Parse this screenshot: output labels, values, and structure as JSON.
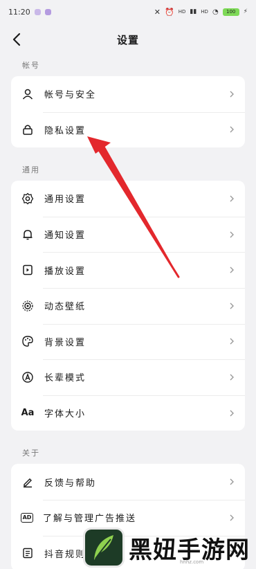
{
  "status_bar": {
    "time": "11:20",
    "signal_label": "HD",
    "battery": "100"
  },
  "header": {
    "title": "设置"
  },
  "sections": [
    {
      "label": "帐号",
      "items": [
        {
          "label": "帐号与安全",
          "icon": "user-icon"
        },
        {
          "label": "隐私设置",
          "icon": "lock-icon"
        }
      ]
    },
    {
      "label": "通用",
      "items": [
        {
          "label": "通用设置",
          "icon": "gear-icon"
        },
        {
          "label": "通知设置",
          "icon": "bell-icon"
        },
        {
          "label": "播放设置",
          "icon": "play-settings-icon"
        },
        {
          "label": "动态壁纸",
          "icon": "live-wallpaper-icon"
        },
        {
          "label": "背景设置",
          "icon": "palette-icon"
        },
        {
          "label": "长辈模式",
          "icon": "elder-mode-icon"
        },
        {
          "label": "字体大小",
          "icon": "font-size-icon",
          "glyph": "Aa"
        }
      ]
    },
    {
      "label": "关于",
      "items": [
        {
          "label": "反馈与帮助",
          "icon": "edit-icon"
        },
        {
          "label": "了解与管理广告推送",
          "icon": "ad-icon",
          "glyph": "AD"
        },
        {
          "label": "抖音规则",
          "icon": "rules-icon"
        }
      ]
    }
  ],
  "watermark": {
    "text": "黑妞手游网",
    "sub": "hnhz.com"
  },
  "colors": {
    "background": "#f2f2f4",
    "card": "#ffffff",
    "annotation_arrow": "#e3282d"
  }
}
